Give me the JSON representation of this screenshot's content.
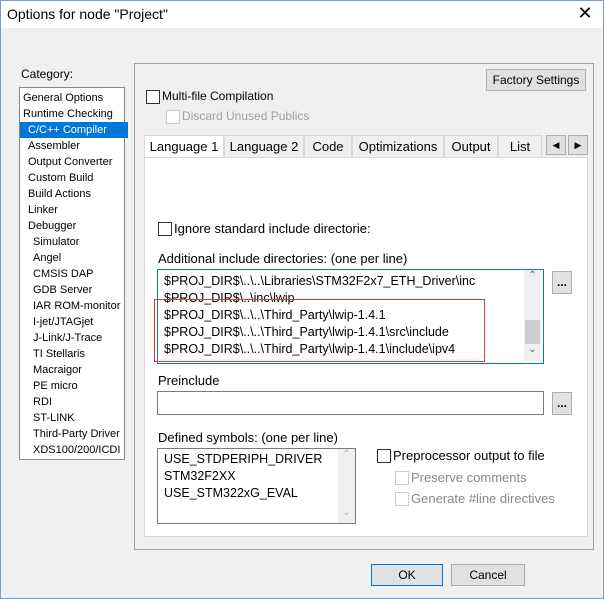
{
  "window": {
    "title": "Options for node \"Project\"",
    "close_icon": "close-icon"
  },
  "category": {
    "label": "Category:",
    "items": [
      "General Options",
      "Runtime Checking",
      "C/C++ Compiler",
      "Assembler",
      "Output Converter",
      "Custom Build",
      "Build Actions",
      "Linker",
      "Debugger",
      "Simulator",
      "Angel",
      "CMSIS DAP",
      "GDB Server",
      "IAR ROM-monitor",
      "I-jet/JTAGjet",
      "J-Link/J-Trace",
      "TI Stellaris",
      "Macraigor",
      "PE micro",
      "RDI",
      "ST-LINK",
      "Third-Party Driver",
      "XDS100/200/ICDI"
    ],
    "selected": "C/C++ Compiler"
  },
  "factory_settings": "Factory Settings",
  "multi_file": {
    "label": "Multi-file Compilation",
    "checked": false
  },
  "discard": {
    "label": "Discard Unused Publics",
    "checked": false,
    "disabled": true
  },
  "tabs": [
    "Language 1",
    "Language 2",
    "Code",
    "Optimizations",
    "Output",
    "List"
  ],
  "ignore_std": {
    "label": "Ignore standard include directorie:",
    "checked": false
  },
  "include_dirs": {
    "label": "Additional include directories: (one per line)",
    "lines": [
      "$PROJ_DIR$\\..\\..\\Libraries\\STM32F2x7_ETH_Driver\\inc",
      "$PROJ_DIR$\\..\\inc\\lwip",
      "$PROJ_DIR$\\..\\..\\Third_Party\\lwip-1.4.1",
      "$PROJ_DIR$\\..\\..\\Third_Party\\lwip-1.4.1\\src\\include",
      "$PROJ_DIR$\\..\\..\\Third_Party\\lwip-1.4.1\\include\\ipv4"
    ],
    "browse": "..."
  },
  "preinclude": {
    "label": "Preinclude",
    "value": "",
    "browse": "..."
  },
  "defined_symbols": {
    "label": "Defined symbols: (one per line)",
    "lines": [
      "USE_STDPERIPH_DRIVER",
      "STM32F2XX",
      "USE_STM322xG_EVAL"
    ]
  },
  "preprocessor": {
    "label": "Preprocessor output to file",
    "checked": false
  },
  "preserve": {
    "label": "Preserve comments",
    "checked": false
  },
  "generate_line": {
    "label": "Generate #line directives",
    "checked": false
  },
  "highlight_color": "#e53935",
  "ok": "OK",
  "cancel": "Cancel"
}
